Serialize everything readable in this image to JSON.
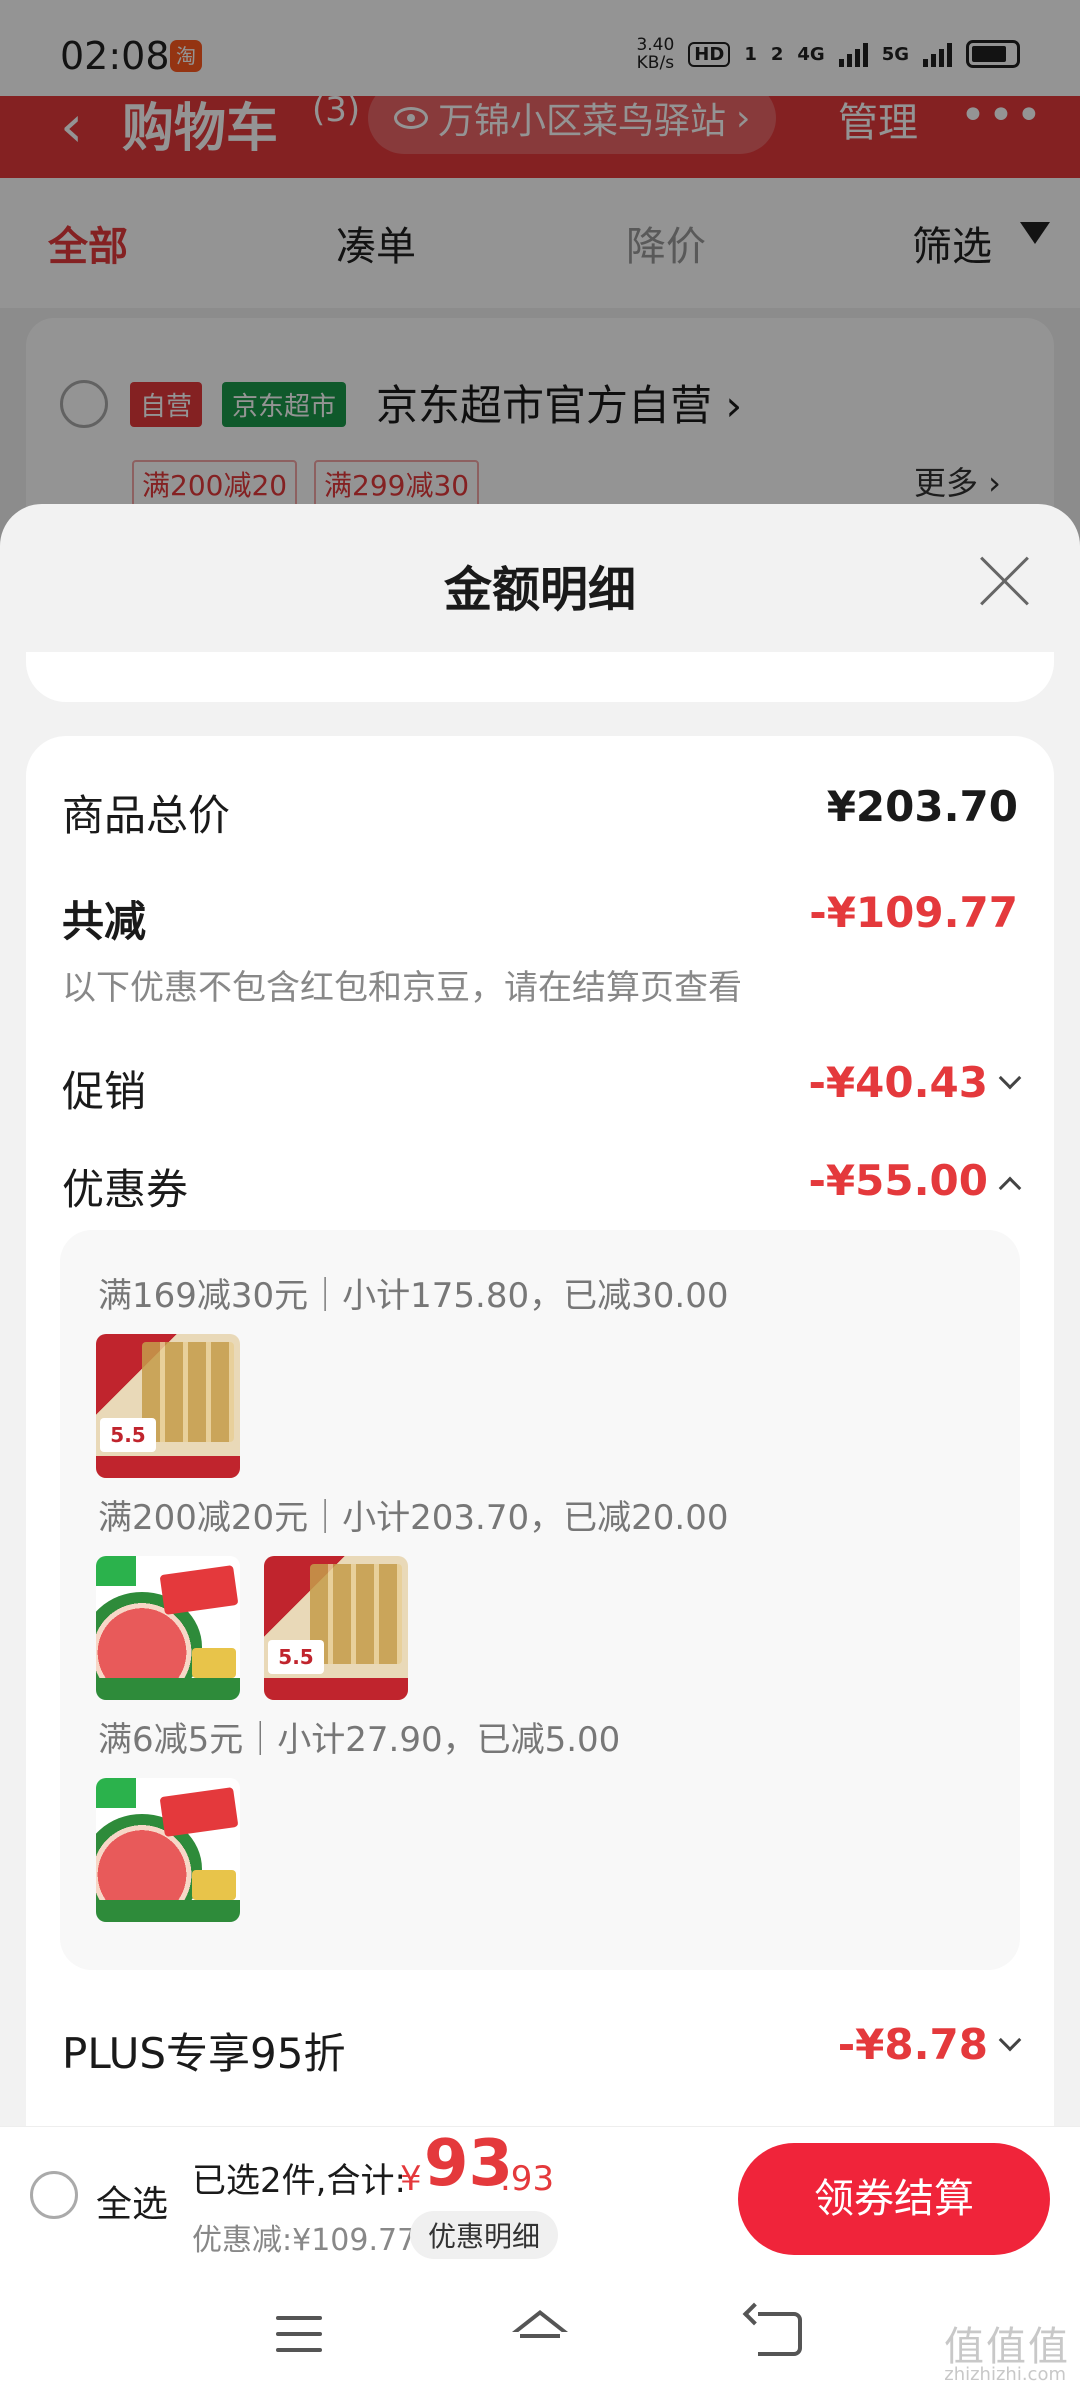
{
  "status_bar": {
    "time": "02:08",
    "taobao_badge": "淘",
    "net_speed_value": "3.40",
    "net_speed_unit": "KB/s",
    "hd": "HD",
    "sim1": "1",
    "sim2": "2",
    "net1": "4G",
    "net2": "5G"
  },
  "cart_header": {
    "back": "‹",
    "title": "购物车",
    "count": "(3)",
    "location": "万锦小区菜鸟驿站",
    "location_chevron": "›",
    "manage": "管理",
    "more": "•••"
  },
  "tabs": [
    {
      "label": "全部",
      "state": "active"
    },
    {
      "label": "凑单",
      "state": "normal"
    },
    {
      "label": "降价",
      "state": "faded"
    },
    {
      "label": "筛选",
      "state": "normal"
    }
  ],
  "store": {
    "tag_self": "自营",
    "tag_supermarket": "京东超市",
    "name": "京东超市官方自营 ›",
    "promo_1": "满200减20",
    "promo_2": "满299减30",
    "more": "更多 ›"
  },
  "sheet": {
    "title": "金额明细",
    "total_label": "商品总价",
    "total_value": "¥203.70",
    "reduction_label": "共减",
    "reduction_value": "-¥109.77",
    "reduction_note": "以下优惠不包含红包和京豆，请在结算页查看",
    "promotion_label": "促销",
    "promotion_value": "-¥40.43",
    "coupon_label": "优惠券",
    "coupon_value": "-¥55.00",
    "coupons": [
      {
        "text": "满169减30元｜小计175.80，已减30.00",
        "items": [
          "paper-product"
        ]
      },
      {
        "text": "满200减20元｜小计203.70，已减20.00",
        "items": [
          "watermelon-product",
          "paper-product"
        ]
      },
      {
        "text": "满6减5元｜小计27.90，已减5.00",
        "items": [
          "watermelon-product"
        ]
      }
    ],
    "plus_label": "PLUS专享95折",
    "plus_value": "-¥8.78"
  },
  "checkout": {
    "select_all": "全选",
    "selected_summary": "已选2件,合计:",
    "total_currency": "¥",
    "total_int": "93",
    "total_dec": ".93",
    "discount": "优惠减:¥109.77",
    "detail_pill": "优惠明细",
    "button": "领券结算"
  },
  "watermark": {
    "mark": "值值值",
    "domain": "zhizhizhi.com"
  },
  "colors": {
    "brand_red": "#e4393c",
    "checkout_red": "#f0243a",
    "supermarket_green": "#1b9a4a"
  },
  "icons": [
    "search-icon",
    "eye-icon",
    "filter-icon",
    "close-icon",
    "chevron-down-icon",
    "chevron-up-icon",
    "menu-icon",
    "home-icon",
    "back-icon"
  ]
}
